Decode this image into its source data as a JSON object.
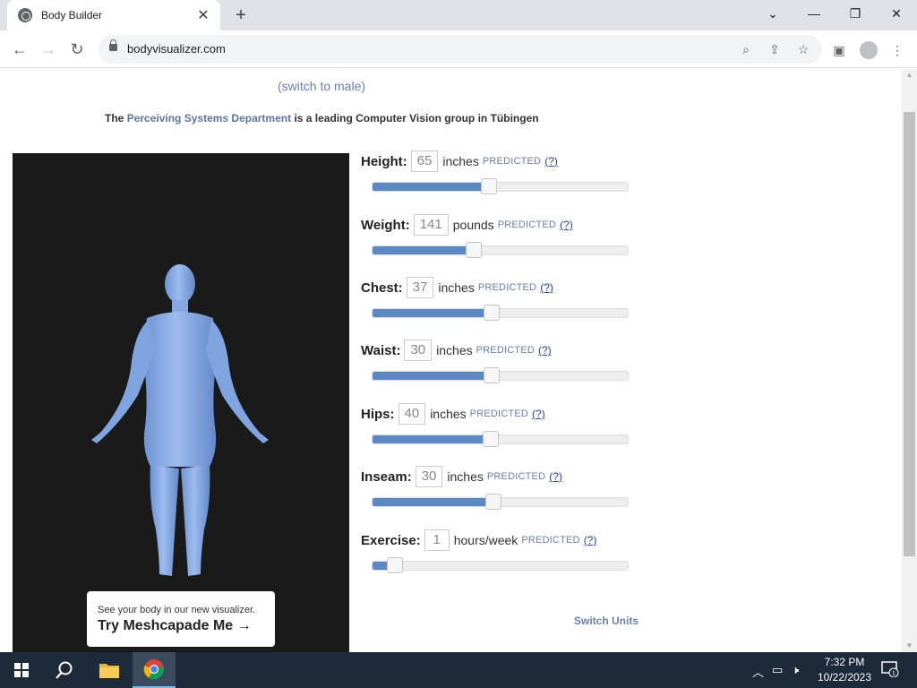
{
  "browser": {
    "tab_title": "Body Builder",
    "url": "bodyvisualizer.com"
  },
  "page": {
    "switch_gender": "(switch to male)",
    "intro_prefix": "The",
    "intro_link": "Perceiving Systems Department",
    "intro_suffix": "is a leading Computer Vision group in Tübingen",
    "promo_small": "See your body in our new visualizer.",
    "promo_big": "Try Meshcapade Me",
    "switch_units": "Switch Units",
    "fields": [
      {
        "label": "Height:",
        "value": "65",
        "unit": "inches",
        "status": "PREDICTED",
        "help": "(?)",
        "fraction": 0.44
      },
      {
        "label": "Weight:",
        "value": "141",
        "unit": "pounds",
        "status": "PREDICTED",
        "help": "(?)",
        "fraction": 0.38
      },
      {
        "label": "Chest:",
        "value": "37",
        "unit": "inches",
        "status": "PREDICTED",
        "help": "(?)",
        "fraction": 0.45
      },
      {
        "label": "Waist:",
        "value": "30",
        "unit": "inches",
        "status": "PREDICTED",
        "help": "(?)",
        "fraction": 0.45
      },
      {
        "label": "Hips:",
        "value": "40",
        "unit": "inches",
        "status": "PREDICTED",
        "help": "(?)",
        "fraction": 0.445
      },
      {
        "label": "Inseam:",
        "value": "30",
        "unit": "inches",
        "status": "PREDICTED",
        "help": "(?)",
        "fraction": 0.455
      },
      {
        "label": "Exercise:",
        "value": "1",
        "unit": "hours/week",
        "status": "PREDICTED",
        "help": "(?)",
        "fraction": 0.07
      }
    ]
  },
  "taskbar": {
    "time": "7:32 PM",
    "date": "10/22/2023",
    "notification_count": "1"
  },
  "colors": {
    "slider_fill": "#5a89c4",
    "body_model": "#7fa6e0",
    "link": "#5a77a5"
  }
}
